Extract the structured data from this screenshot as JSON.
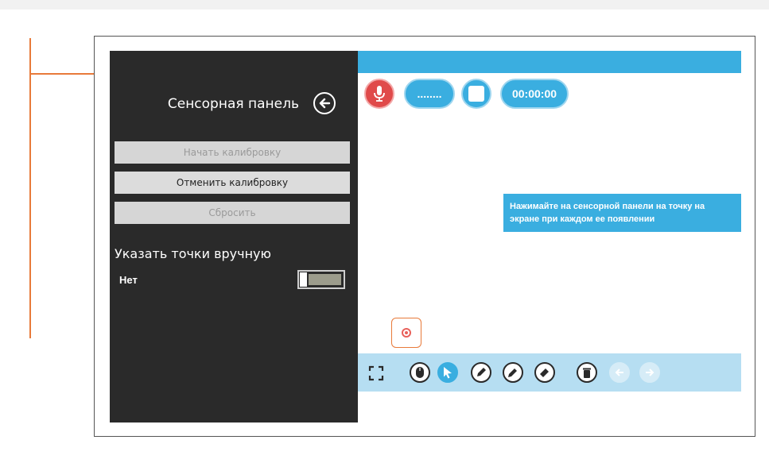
{
  "sidebar": {
    "title": "Сенсорная панель",
    "buttons": {
      "start_calibration": "Начать калибровку",
      "cancel_calibration": "Отменить калибровку",
      "reset": "Сбросить"
    },
    "manual_points": {
      "heading": "Указать точки вручную",
      "toggle_label": "Нет",
      "toggle_on": false
    }
  },
  "toolbar_top": {
    "dots_label": "........",
    "timer": "00:00:00"
  },
  "tooltip": {
    "line1": "Нажимайте на сенсорной панели на точку на",
    "line2": "экране при каждом ее появлении"
  },
  "bottom_tools": [
    {
      "name": "fullscreen-icon",
      "state": "normal"
    },
    {
      "name": "mouse-icon",
      "state": "normal"
    },
    {
      "name": "pointer-icon",
      "state": "selected"
    },
    {
      "name": "pen-icon",
      "state": "normal"
    },
    {
      "name": "marker-icon",
      "state": "normal"
    },
    {
      "name": "eraser-icon",
      "state": "normal"
    },
    {
      "name": "trash-icon",
      "state": "normal"
    },
    {
      "name": "undo-icon",
      "state": "disabled"
    },
    {
      "name": "redo-icon",
      "state": "disabled"
    }
  ],
  "colors": {
    "accent": "#3aaee0",
    "sidebar_bg": "#2a2a2a",
    "annotation": "#e87a3a",
    "record": "#e04a4a"
  }
}
